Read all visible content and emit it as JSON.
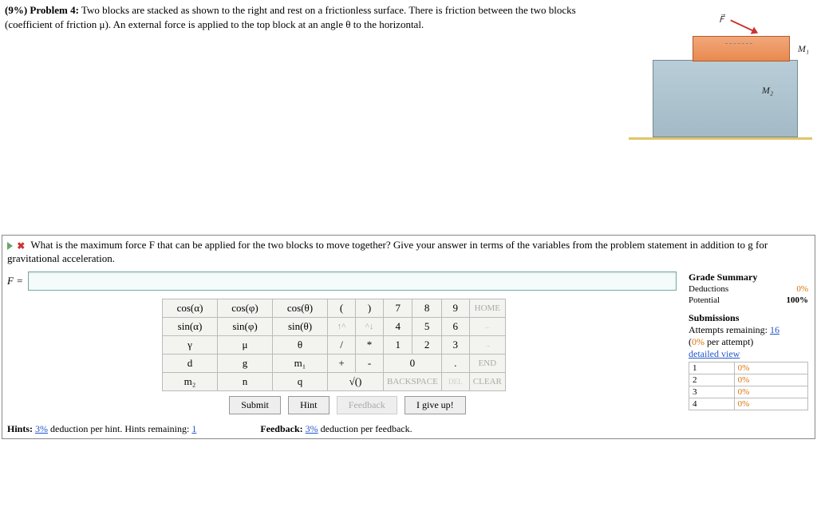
{
  "problem": {
    "prefix": "(9%) Problem 4:",
    "text": "Two blocks are stacked as shown to the right and rest on a frictionless surface. There is friction between the two blocks (coefficient of friction μ). An external force is applied to the top block at an angle θ to the horizontal.",
    "force_label": "F⃗",
    "m1_label": "M₁",
    "m2_label": "M₂"
  },
  "question": "What is the maximum force F that can be applied for the two blocks to move together? Give your answer in terms of the variables from the problem statement in addition to g for gravitational acceleration.",
  "answer": {
    "label": "F =",
    "value": ""
  },
  "keypad": {
    "row1": [
      "cos(α)",
      "cos(φ)",
      "cos(θ)",
      "(",
      ")",
      "7",
      "8",
      "9",
      "HOME"
    ],
    "row2": [
      "sin(α)",
      "sin(φ)",
      "sin(θ)",
      "↑^",
      "^↓",
      "4",
      "5",
      "6",
      "←"
    ],
    "row3": [
      "γ",
      "μ",
      "θ",
      "/",
      "*",
      "1",
      "2",
      "3",
      "→"
    ],
    "row4": [
      "d",
      "g",
      "m₁",
      "+",
      "-",
      "0",
      ".",
      "END"
    ],
    "row5": [
      "m₂",
      "n",
      "q",
      "√()",
      "BACKSPACE",
      "DEL",
      "CLEAR"
    ]
  },
  "actions": {
    "submit": "Submit",
    "hint": "Hint",
    "feedback": "Feedback",
    "giveup": "I give up!"
  },
  "summary": {
    "title": "Grade Summary",
    "deductions_label": "Deductions",
    "deductions": "0%",
    "potential_label": "Potential",
    "potential": "100%",
    "subs_title": "Submissions",
    "attempts_label": "Attempts remaining:",
    "attempts_remaining": "16",
    "per_attempt": "(0% per attempt)",
    "detailed_link": "detailed view",
    "rows": [
      {
        "n": "1",
        "v": "0%"
      },
      {
        "n": "2",
        "v": "0%"
      },
      {
        "n": "3",
        "v": "0%"
      },
      {
        "n": "4",
        "v": "0%"
      }
    ]
  },
  "hints": {
    "hint_prefix": "Hints:",
    "hint_pct": "3%",
    "hint_text": "deduction per hint. Hints remaining:",
    "hint_remaining": "1",
    "fb_prefix": "Feedback:",
    "fb_pct": "3%",
    "fb_text": "deduction per feedback."
  }
}
